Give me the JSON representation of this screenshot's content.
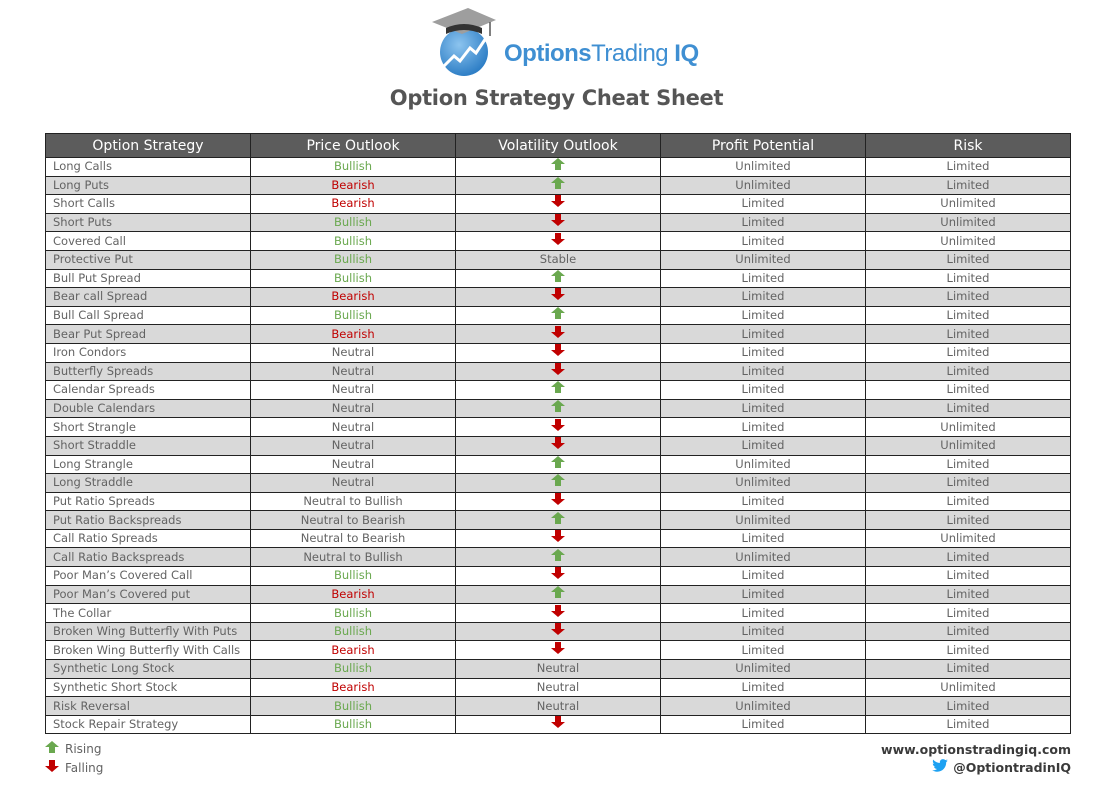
{
  "brand": {
    "name_bold": "Options",
    "name_light": "Trading",
    "name_suffix": " IQ",
    "logo_icon": "graduation-cap-globe-chart-icon"
  },
  "title": "Option Strategy Cheat Sheet",
  "colors": {
    "header_bg": "#5c5c5c",
    "alt_row_bg": "#d9d9d9",
    "bullish": "#6aa84f",
    "bearish": "#c00000",
    "rising_arrow": "#6aa84f",
    "falling_arrow": "#c00000",
    "brand_blue": "#3f8fd2"
  },
  "table": {
    "columns": [
      "Option Strategy",
      "Price Outlook",
      "Volatility Outlook",
      "Profit Potential",
      "Risk"
    ],
    "rows": [
      {
        "strategy": "Long Calls",
        "price": "Bullish",
        "volatility": "rising",
        "profit": "Unlimited",
        "risk": "Limited"
      },
      {
        "strategy": "Long Puts",
        "price": "Bearish",
        "volatility": "rising",
        "profit": "Unlimited",
        "risk": "Limited"
      },
      {
        "strategy": "Short Calls",
        "price": "Bearish",
        "volatility": "falling",
        "profit": "Limited",
        "risk": "Unlimited"
      },
      {
        "strategy": "Short Puts",
        "price": "Bullish",
        "volatility": "falling",
        "profit": "Limited",
        "risk": "Unlimited"
      },
      {
        "strategy": "Covered Call",
        "price": "Bullish",
        "volatility": "falling",
        "profit": "Limited",
        "risk": "Unlimited"
      },
      {
        "strategy": "Protective Put",
        "price": "Bullish",
        "volatility": "Stable",
        "profit": "Unlimited",
        "risk": "Limited"
      },
      {
        "strategy": "Bull Put Spread",
        "price": "Bullish",
        "volatility": "rising",
        "profit": "Limited",
        "risk": "Limited"
      },
      {
        "strategy": "Bear call Spread",
        "price": "Bearish",
        "volatility": "falling",
        "profit": "Limited",
        "risk": "Limited"
      },
      {
        "strategy": "Bull Call Spread",
        "price": "Bullish",
        "volatility": "rising",
        "profit": "Limited",
        "risk": "Limited"
      },
      {
        "strategy": "Bear Put Spread",
        "price": "Bearish",
        "volatility": "falling",
        "profit": "Limited",
        "risk": "Limited"
      },
      {
        "strategy": "Iron Condors",
        "price": "Neutral",
        "volatility": "falling",
        "profit": "Limited",
        "risk": "Limited"
      },
      {
        "strategy": "Butterfly Spreads",
        "price": "Neutral",
        "volatility": "falling",
        "profit": "Limited",
        "risk": "Limited"
      },
      {
        "strategy": "Calendar Spreads",
        "price": "Neutral",
        "volatility": "rising",
        "profit": "Limited",
        "risk": "Limited"
      },
      {
        "strategy": "Double Calendars",
        "price": "Neutral",
        "volatility": "rising",
        "profit": "Limited",
        "risk": "Limited"
      },
      {
        "strategy": "Short Strangle",
        "price": "Neutral",
        "volatility": "falling",
        "profit": "Limited",
        "risk": "Unlimited"
      },
      {
        "strategy": "Short Straddle",
        "price": "Neutral",
        "volatility": "falling",
        "profit": "Limited",
        "risk": "Unlimited"
      },
      {
        "strategy": "Long Strangle",
        "price": "Neutral",
        "volatility": "rising",
        "profit": "Unlimited",
        "risk": "Limited"
      },
      {
        "strategy": "Long Straddle",
        "price": "Neutral",
        "volatility": "rising",
        "profit": "Unlimited",
        "risk": "Limited"
      },
      {
        "strategy": "Put Ratio Spreads",
        "price": "Neutral to Bullish",
        "volatility": "falling",
        "profit": "Limited",
        "risk": "Limited"
      },
      {
        "strategy": "Put Ratio Backspreads",
        "price": "Neutral to Bearish",
        "volatility": "rising",
        "profit": "Unlimited",
        "risk": "Limited"
      },
      {
        "strategy": "Call Ratio Spreads",
        "price": "Neutral to Bearish",
        "volatility": "falling",
        "profit": "Limited",
        "risk": "Unlimited"
      },
      {
        "strategy": "Call Ratio Backspreads",
        "price": "Neutral to Bullish",
        "volatility": "rising",
        "profit": "Unlimited",
        "risk": "Limited"
      },
      {
        "strategy": "Poor Man’s Covered Call",
        "price": "Bullish",
        "volatility": "falling",
        "profit": "Limited",
        "risk": "Limited"
      },
      {
        "strategy": "Poor Man’s Covered put",
        "price": "Bearish",
        "volatility": "rising",
        "profit": "Limited",
        "risk": "Limited"
      },
      {
        "strategy": "The Collar",
        "price": "Bullish",
        "volatility": "falling",
        "profit": "Limited",
        "risk": "Limited"
      },
      {
        "strategy": "Broken Wing Butterfly With Puts",
        "price": "Bullish",
        "volatility": "falling",
        "profit": "Limited",
        "risk": "Limited"
      },
      {
        "strategy": "Broken Wing Butterfly With Calls",
        "price": "Bearish",
        "volatility": "falling",
        "profit": "Limited",
        "risk": "Limited"
      },
      {
        "strategy": "Synthetic Long Stock",
        "price": "Bullish",
        "volatility": "Neutral",
        "profit": "Unlimited",
        "risk": "Limited"
      },
      {
        "strategy": "Synthetic Short Stock",
        "price": "Bearish",
        "volatility": "Neutral",
        "profit": "Limited",
        "risk": "Unlimited"
      },
      {
        "strategy": "Risk Reversal",
        "price": "Bullish",
        "volatility": "Neutral",
        "profit": "Unlimited",
        "risk": "Limited"
      },
      {
        "strategy": "Stock Repair Strategy",
        "price": "Bullish",
        "volatility": "falling",
        "profit": "Limited",
        "risk": "Limited"
      }
    ]
  },
  "legend": {
    "rising": {
      "label": "Rising",
      "icon": "arrow-up-icon"
    },
    "falling": {
      "label": "Falling",
      "icon": "arrow-down-icon"
    }
  },
  "footer": {
    "website": "www.optionstradingiq.com",
    "twitter_handle": "@OptiontradinIQ",
    "twitter_icon": "twitter-bird-icon"
  }
}
